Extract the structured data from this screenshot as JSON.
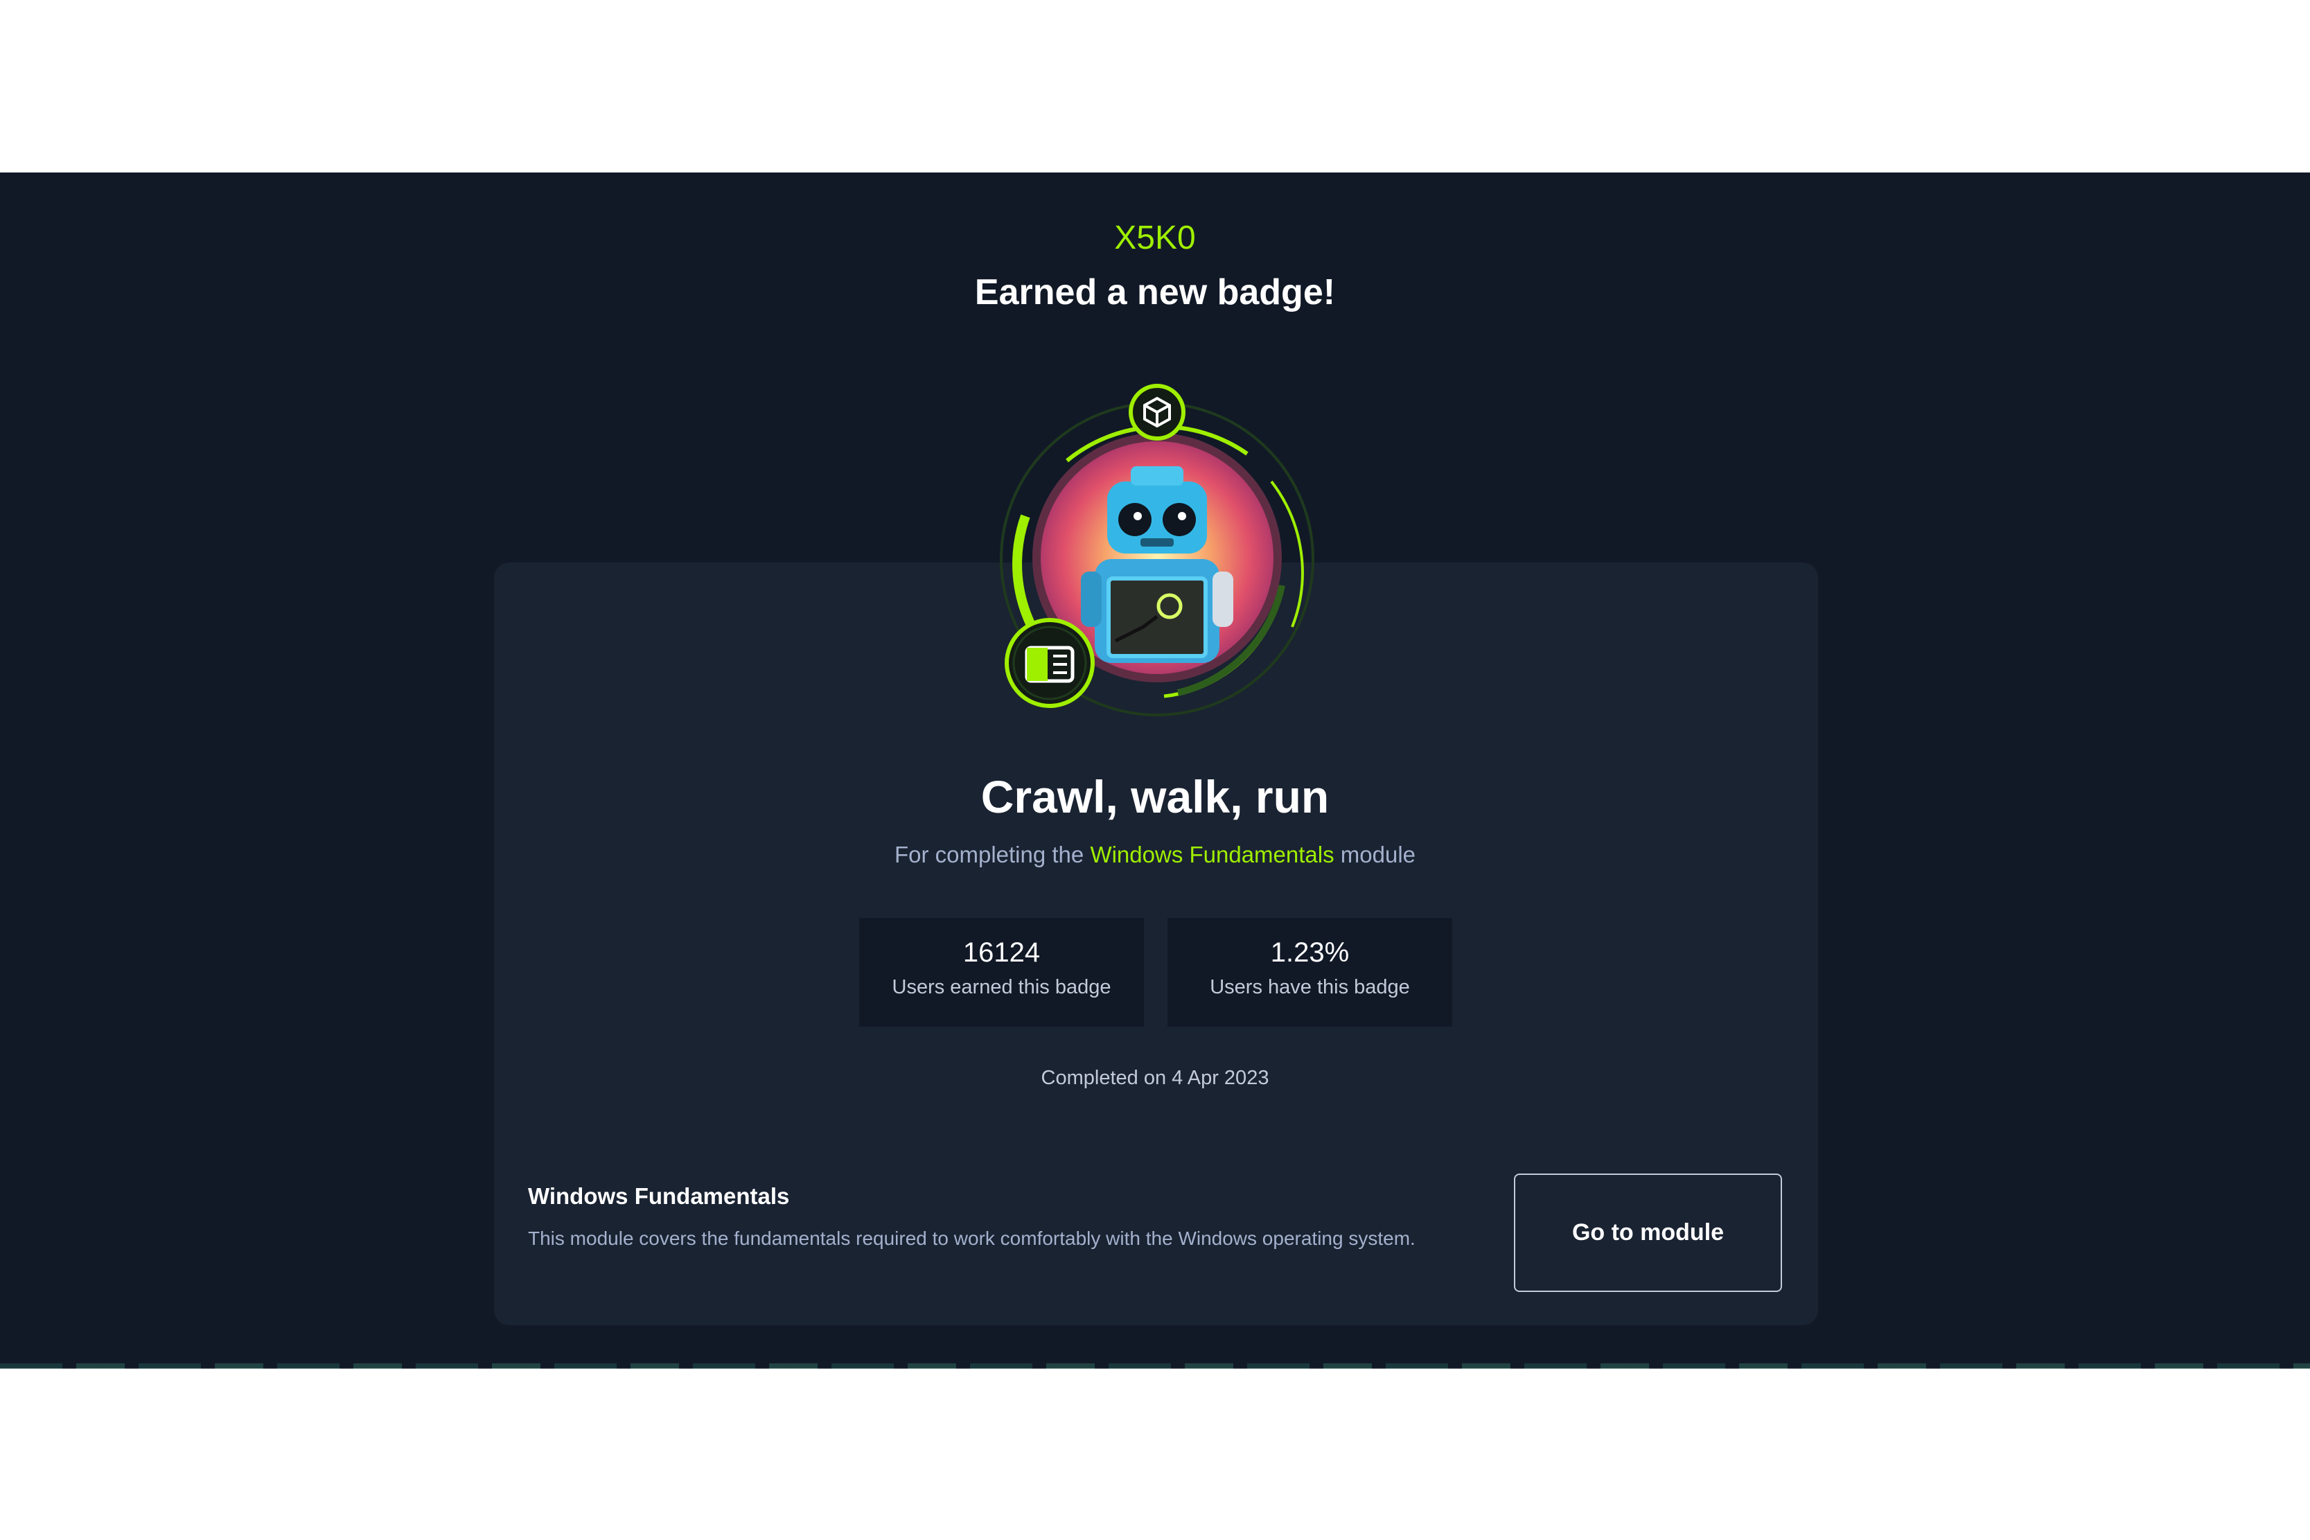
{
  "user": {
    "name": "X5K0"
  },
  "headline": "Earned a new badge!",
  "badge": {
    "title": "Crawl, walk, run",
    "desc_prefix": "For completing the",
    "desc_link": "Windows Fundamentals",
    "desc_suffix": "module",
    "image_icon": "robot-badge-icon"
  },
  "stats": [
    {
      "value": "16124",
      "label": "Users earned this badge"
    },
    {
      "value": "1.23%",
      "label": "Users have this badge"
    }
  ],
  "completed": "Completed on 4 Apr 2023",
  "module": {
    "name": "Windows Fundamentals",
    "description": "This module covers the fundamentals required to work comfortably with the Windows operating system.",
    "button_label": "Go to module"
  },
  "colors": {
    "background": "#111927",
    "card": "#1a2332",
    "accent": "#9fef00",
    "muted_text": "#a4b1cd"
  }
}
